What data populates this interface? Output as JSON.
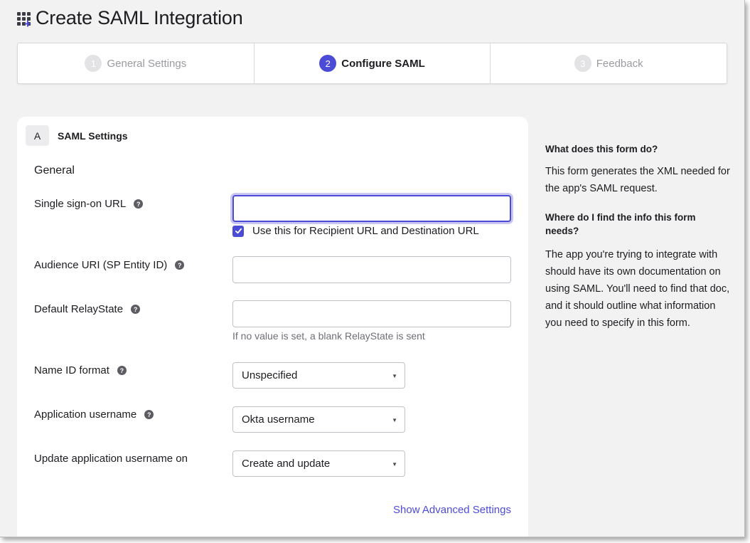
{
  "page": {
    "title": "Create SAML Integration"
  },
  "stepper": {
    "steps": [
      {
        "number": "1",
        "label": "General Settings",
        "state": "inactive"
      },
      {
        "number": "2",
        "label": "Configure SAML",
        "state": "active"
      },
      {
        "number": "3",
        "label": "Feedback",
        "state": "inactive"
      }
    ]
  },
  "section": {
    "badge": "A",
    "title": "SAML Settings",
    "subheading": "General"
  },
  "fields": {
    "sso_url": {
      "label": "Single sign-on URL",
      "value": "",
      "checkbox_label": "Use this for Recipient URL and Destination URL",
      "checkbox_checked": true
    },
    "audience_uri": {
      "label": "Audience URI (SP Entity ID)",
      "value": ""
    },
    "relay_state": {
      "label": "Default RelayState",
      "value": "",
      "hint": "If no value is set, a blank RelayState is sent"
    },
    "name_id_format": {
      "label": "Name ID format",
      "selected": "Unspecified"
    },
    "app_username": {
      "label": "Application username",
      "selected": "Okta username"
    },
    "update_username_on": {
      "label": "Update application username on",
      "selected": "Create and update"
    }
  },
  "links": {
    "advanced": "Show Advanced Settings"
  },
  "help": {
    "q1": "What does this form do?",
    "a1": "This form generates the XML needed for the app's SAML request.",
    "q2": "Where do I find the info this form needs?",
    "a2": "The app you're trying to integrate with should have its own documentation on using SAML. You'll need to find that doc, and it should outline what information you need to specify in this form."
  },
  "icons": {
    "app": "apps-grid-plus-icon",
    "help": "question-circle-icon",
    "checkbox": "checkmark-icon",
    "select": "caret-down-icon"
  },
  "colors": {
    "accent": "#4c4bd6",
    "background": "#f2f2f2",
    "card": "#ffffff",
    "muted_text": "#9a9aa1"
  }
}
